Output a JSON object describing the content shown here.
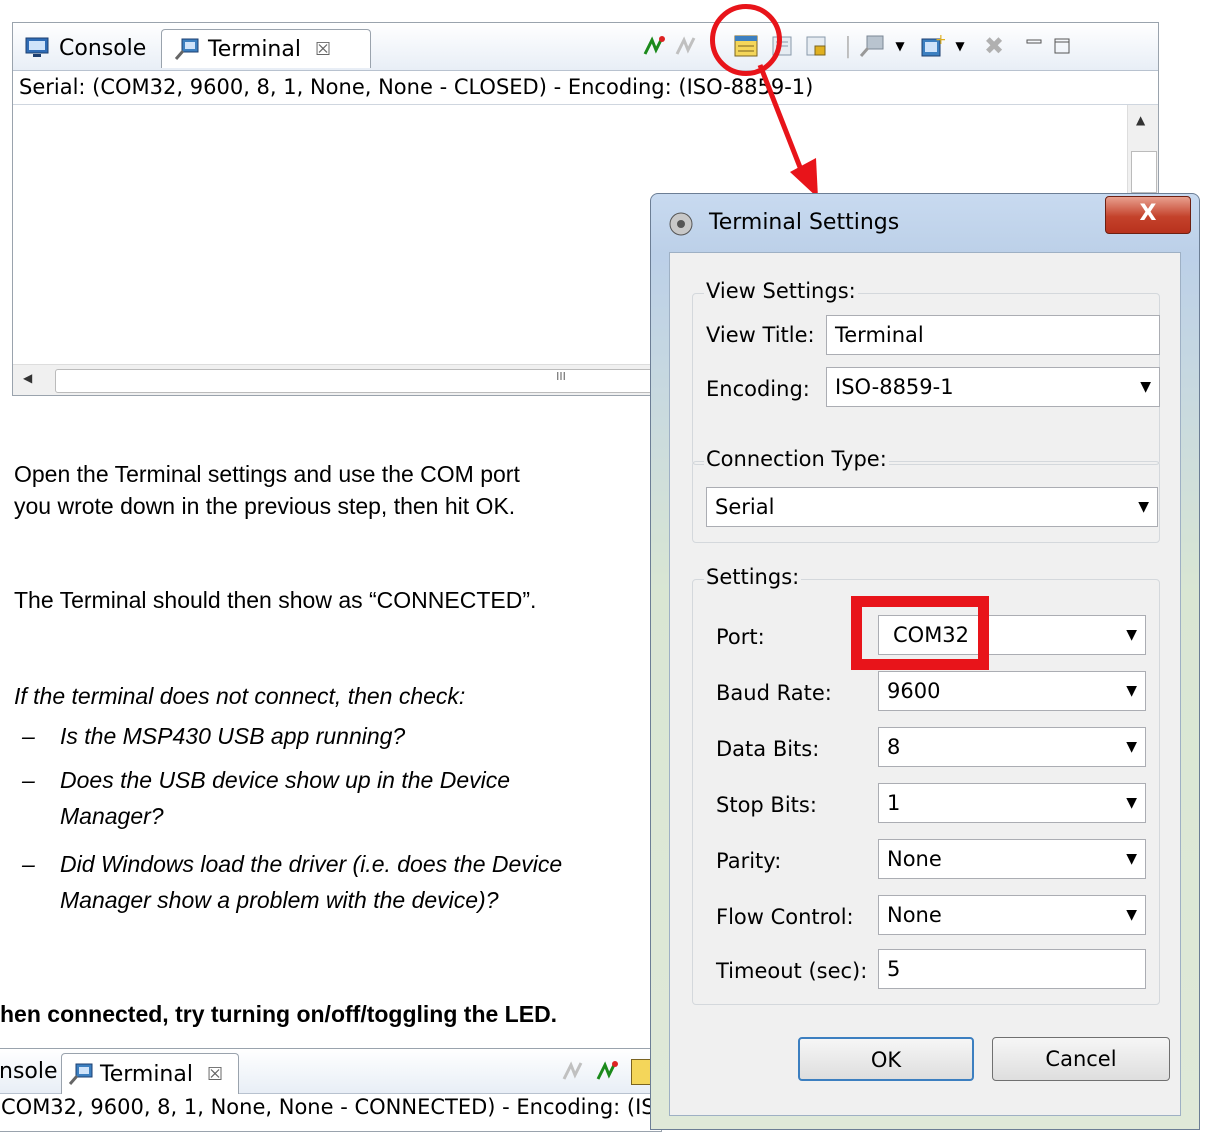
{
  "top_view": {
    "tabs": [
      {
        "label": "Console"
      },
      {
        "label": "Terminal"
      }
    ],
    "status": "Serial: (COM32, 9600, 8, 1, None, None - CLOSED) - Encoding: (ISO-8859-1)",
    "scroll_glyph": "III"
  },
  "instructions": {
    "heading_bottom": "hen connected, try turning on/off/toggling the LED.",
    "step1_line1": "Open the Terminal settings and use the COM port",
    "step1_line2": "you wrote down in the previous step, then hit OK.",
    "step2": "The Terminal should then show as “CONNECTED”.",
    "check_intro": "If the terminal does not connect, then check:",
    "checks": [
      {
        "line1": "Is the MSP430 USB app running?",
        "line2": ""
      },
      {
        "line1": "Does the USB device show up in the Device",
        "line2": "Manager?"
      },
      {
        "line1": "Did Windows load the driver (i.e. does the Device",
        "line2": "Manager show a problem with the device)?"
      }
    ],
    "bullet": "–"
  },
  "bottom_view": {
    "tab_console": "nsole",
    "tab_terminal": "Terminal",
    "status": "COM32, 9600, 8, 1, None, None - CONNECTED) - Encoding: (IS"
  },
  "dialog": {
    "title": "Terminal Settings",
    "close_label": "X",
    "view_settings": {
      "group_label": "View Settings:",
      "view_title_label": "View Title:",
      "view_title_value": "Terminal",
      "encoding_label": "Encoding:",
      "encoding_value": "ISO-8859-1"
    },
    "connection_type": {
      "group_label": "Connection Type:",
      "value": "Serial"
    },
    "settings": {
      "group_label": "Settings:",
      "port_label": "Port:",
      "port_value": "COM32",
      "baud_label": "Baud Rate:",
      "baud_value": "9600",
      "data_label": "Data Bits:",
      "data_value": "8",
      "stop_label": "Stop Bits:",
      "stop_value": "1",
      "parity_label": "Parity:",
      "parity_value": "None",
      "flow_label": "Flow Control:",
      "flow_value": "None",
      "timeout_label": "Timeout (sec):",
      "timeout_value": "5"
    },
    "ok_label": "OK",
    "cancel_label": "Cancel"
  },
  "colors": {
    "highlight": "#e8141a",
    "accent": "#3c7fc0"
  }
}
